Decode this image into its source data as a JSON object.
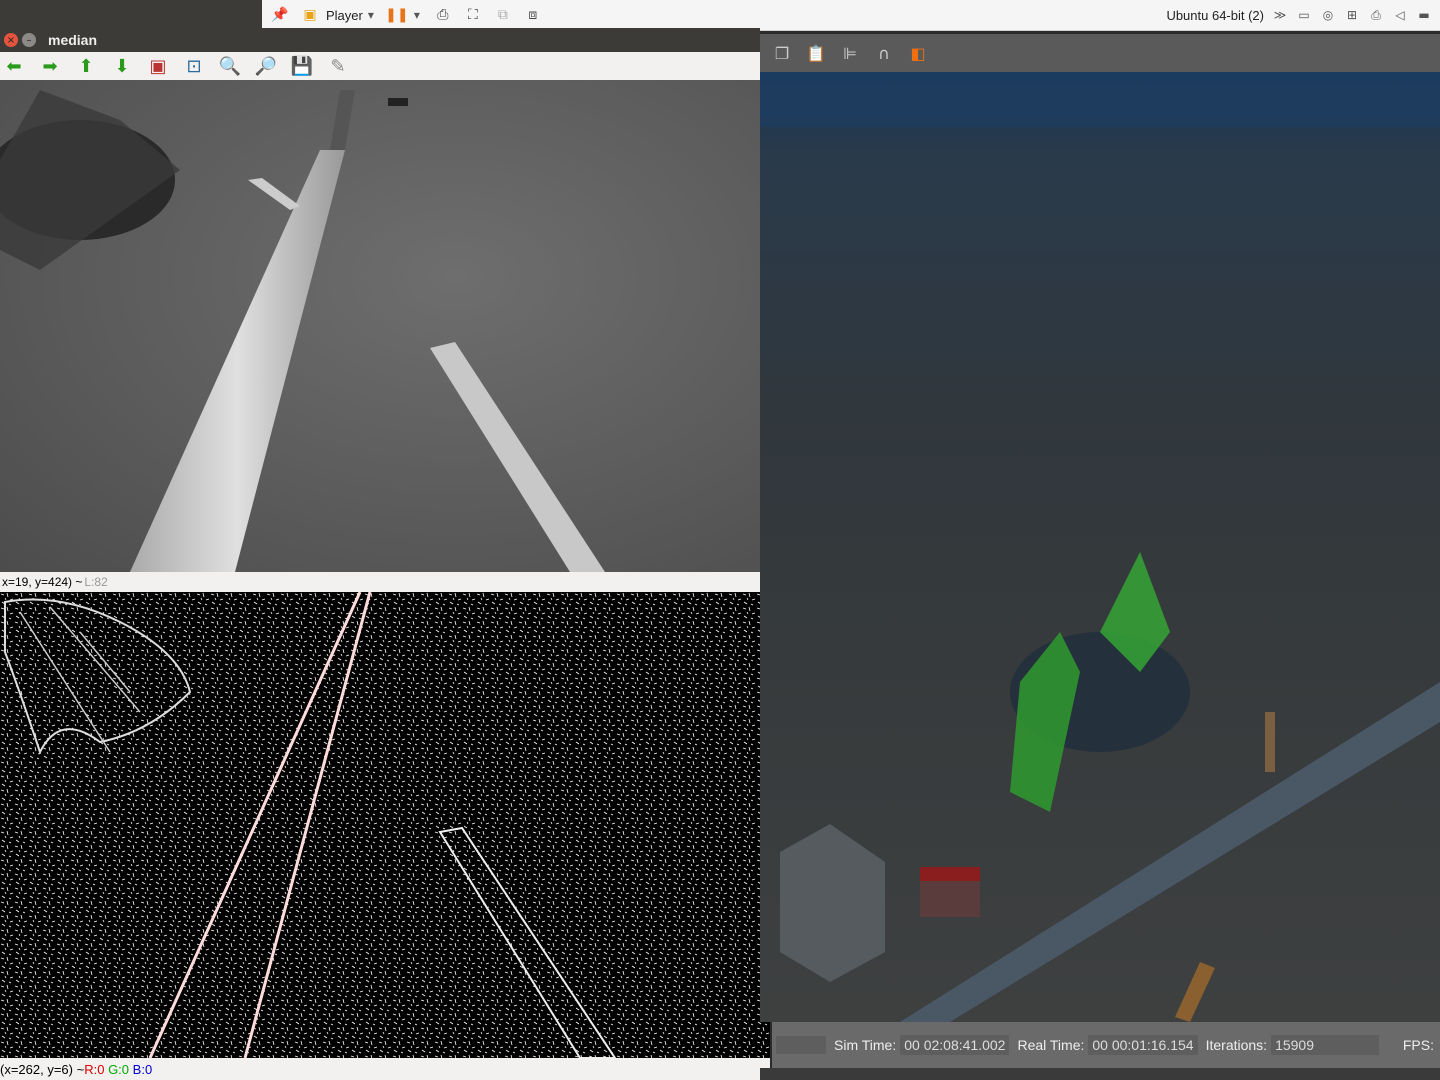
{
  "vm": {
    "player_label": "Player",
    "vm_name": "Ubuntu 64-bit (2)"
  },
  "median_window": {
    "title": "median",
    "status_coords": "x=19, y=424) ~ ",
    "status_level": "L:82"
  },
  "edges_window": {
    "status_coords": "(x=262, y=6) ~ ",
    "r": "R:0",
    "g": "G:0",
    "b": "B:0"
  },
  "gazebo": {
    "sim_time_label": "Sim Time:",
    "sim_time": "00 02:08:41.002",
    "real_time_label": "Real Time:",
    "real_time": "00 00:01:16.154",
    "iterations_label": "Iterations:",
    "iterations": "15909",
    "fps_label": "FPS:"
  }
}
